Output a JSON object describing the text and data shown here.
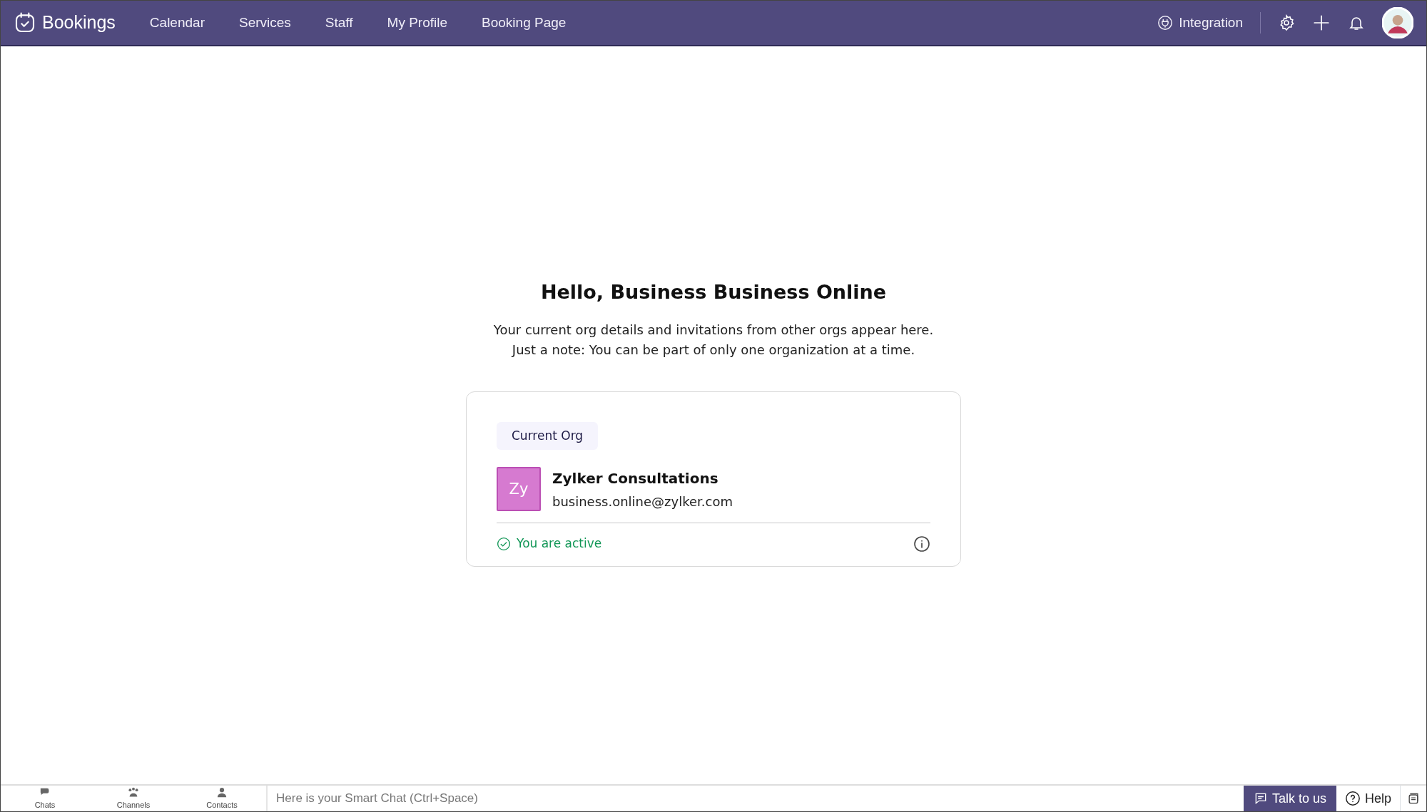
{
  "navbar": {
    "brand": "Bookings",
    "links": [
      {
        "label": "Calendar",
        "selected": false
      },
      {
        "label": "Services",
        "selected": false
      },
      {
        "label": "Staff",
        "selected": false
      },
      {
        "label": "My Profile",
        "selected": false
      },
      {
        "label": "Booking Page",
        "selected": false
      }
    ],
    "integration": "Integration"
  },
  "greeting": {
    "title": "Hello, Business Business Online",
    "lines": [
      "Your current org details and invitations from other orgs appear here.",
      "Just a note: You can be part of only one organization at a time."
    ]
  },
  "org_card": {
    "tag": "Current Org",
    "initials": "Zy",
    "color": "#d67ad0",
    "name": "Zylker Consultations",
    "email": "business.online@zylker.com",
    "active": true,
    "status": "You are active"
  },
  "bottom_bar": {
    "tabs": [
      {
        "label": "Chats"
      },
      {
        "label": "Channels"
      },
      {
        "label": "Contacts"
      }
    ],
    "chat_placeholder": "Here is your Smart Chat (Ctrl+Space)",
    "talk": "Talk to us",
    "help": "Help"
  }
}
